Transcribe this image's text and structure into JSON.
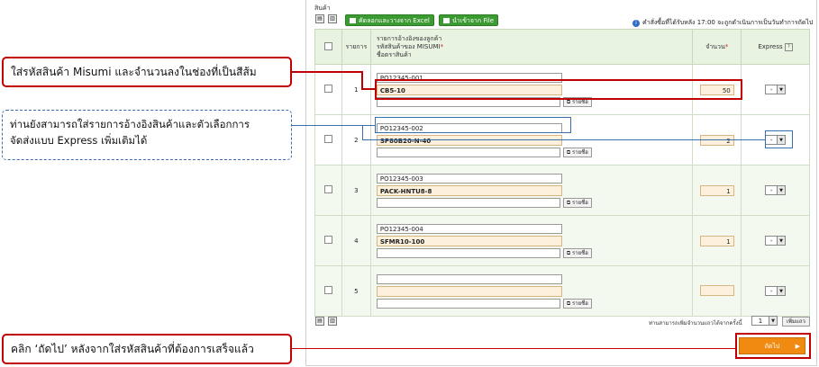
{
  "section_title": "สินค้า",
  "toolbar": {
    "paste_excel": "คัดลอกและวางจาก Excel",
    "import_file": "นำเข้าจาก File",
    "cutoff_note": "คำสั่งซื้อที่ได้รับหลัง 17:00 จะถูกดำเนินการเป็นวันทำการถัดไป"
  },
  "table": {
    "headers": {
      "index": "รายการ",
      "ref_line1": "รายการอ้างอิงของลูกค้า",
      "ref_line2": "รหัสสินค้าของ MISUMI",
      "ref_line3": "ชื่อตราสินค้า",
      "required_mark": "*",
      "qty": "จำนวน",
      "express": "Express",
      "help": "?"
    },
    "rows": [
      {
        "no": "1",
        "ref": "PO12345-001",
        "part": "CB5-10",
        "desc": "",
        "desc_btn": "รายชื่อ",
        "qty": "50",
        "express": "-"
      },
      {
        "no": "2",
        "ref": "PO12345-002",
        "part": "SP80B20-N-40",
        "desc": "",
        "desc_btn": "รายชื่อ",
        "qty": "2",
        "express": "-"
      },
      {
        "no": "3",
        "ref": "PO12345-003",
        "part": "PACK-HNTU8-8",
        "desc": "",
        "desc_btn": "รายชื่อ",
        "qty": "1",
        "express": "-"
      },
      {
        "no": "4",
        "ref": "PO12345-004",
        "part": "SFMR10-100",
        "desc": "",
        "desc_btn": "รายชื่อ",
        "qty": "1",
        "express": "-"
      },
      {
        "no": "5",
        "ref": "",
        "part": "",
        "desc": "",
        "desc_btn": "รายชื่อ",
        "qty": "",
        "express": "-"
      }
    ]
  },
  "footer": {
    "add_rows_note": "ท่านสามารถเพิ่มจำนวนแถวได้จากครั้งนี้",
    "add_rows_value": "1",
    "add_rows_btn": "เพิ่มแถว",
    "next_btn": "ถัดไป",
    "next_arrow": "▶"
  },
  "callouts": {
    "c1": "ใส่รหัสสินค้า Misumi และจำนวนลงในช่องที่เป็นสีส้ม",
    "c2_line1": "ท่านยังสามารถใส่รายการอ้างอิงสินค้าและตัวเลือกการ",
    "c2_line2": "จัดส่งแบบ Express เพิ่มเติมได้",
    "c3": "คลิก ‘ถัดไป’ หลังจากใส่รหัสสินค้าที่ต้องการเสร็จแล้ว"
  },
  "colors": {
    "accent_green": "#3c9a32",
    "orange_button": "#f08a10",
    "highlight_red": "#c00000",
    "highlight_blue": "#3a6dab",
    "orange_field": "#fdf1dd"
  }
}
